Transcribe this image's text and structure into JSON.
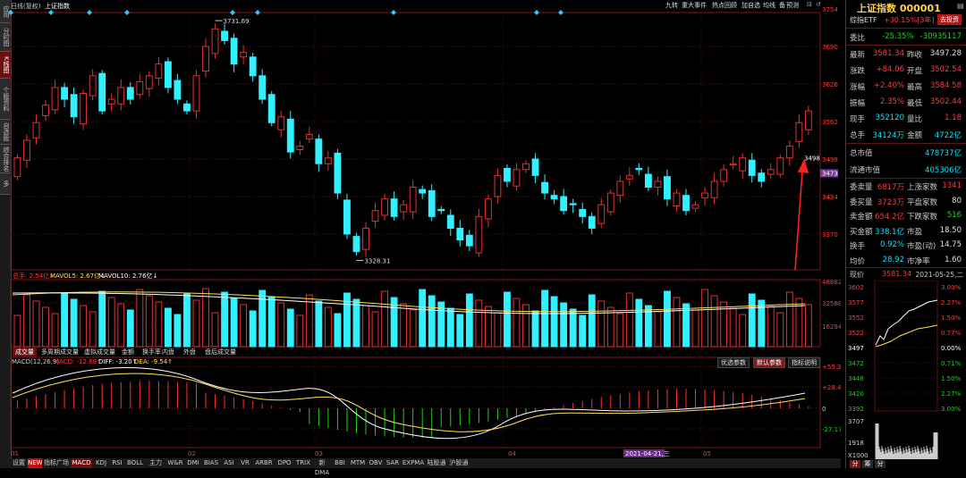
{
  "left_tabs": [
    "应用",
    "分时图",
    "K线图",
    "个股资料",
    "自选股",
    "综合排名",
    "多"
  ],
  "left_active": 2,
  "chart_header": {
    "period": "日线(复权)",
    "name": "上证指数"
  },
  "toolbar": [
    "九转",
    "重大事件",
    "热点回顾",
    "加自选",
    "均线",
    "备",
    "预测"
  ],
  "price_axis": {
    "labels": [
      "3754",
      "3690",
      "3626",
      "3562",
      "3498",
      "3434",
      "3370"
    ]
  },
  "price_current_tag": "3473",
  "last_price_label": "3498",
  "annotations": {
    "high": "3731.69",
    "low": "3328.31"
  },
  "volume_header": {
    "total": "总手: 2.54亿↓",
    "ma5": "MAVOL5: 2.67亿↓",
    "ma10": "MAVOL10: 2.76亿↓"
  },
  "volume_axis": [
    "48882",
    "32588",
    "16294"
  ],
  "volume_tabs": [
    "成交量",
    "多周期成交量",
    "虚拟成交量",
    "金额",
    "换手率",
    "内盘",
    "外盘",
    "盘后成交量"
  ],
  "macd_header": {
    "params": "MACD(12,26,9)",
    "macd": "MACD: -12.68↑",
    "diff": "DIFF: -3.20↑",
    "dea": "DEA: -9.54↑"
  },
  "macd_buttons": [
    "优选参数",
    "默认参数",
    "指标说明"
  ],
  "macd_axis": [
    "+55.30",
    "+28.48",
    "0",
    "-27.17"
  ],
  "x_axis": {
    "labels": [
      "01",
      "02",
      "03",
      "04",
      "05"
    ],
    "highlight": "2021-04-21,三"
  },
  "bottom_tabs": [
    "设置",
    "NEW",
    "指标广场",
    "MACD",
    "KDJ",
    "RSI",
    "BOLL",
    "主力",
    "W&R",
    "DMI",
    "BIAS",
    "ASI",
    "VR",
    "ARBR",
    "DPO",
    "TRIX",
    "新DMA",
    "BBI",
    "MTM",
    "OBV",
    "SAR",
    "EXPMA",
    "陆股通",
    "沪股通"
  ],
  "right_panel": {
    "title": "上证指数 000001",
    "etf": "综指ETF",
    "etf_change": "+30.15%[3年]",
    "go": "去投资",
    "ratio_label": "委比",
    "ratio_value": "-25.35%",
    "ratio_diff": "-30935117",
    "rows": [
      {
        "l1": "最新",
        "v1": "3581.34",
        "l2": "昨收",
        "v2": "3497.28"
      },
      {
        "l1": "涨跌",
        "v1": "+84.06",
        "l2": "开盘",
        "v2": "3502.54"
      },
      {
        "l1": "涨幅",
        "v1": "+2.40%",
        "l2": "最高",
        "v2": "3584.58"
      },
      {
        "l1": "振幅",
        "v1": "2.35%",
        "l2": "最低",
        "v2": "3502.44"
      },
      {
        "l1": "现手",
        "v1": "352120",
        "l2": "量比",
        "v2": "1.18"
      },
      {
        "l1": "总手",
        "v1": "34124万",
        "l2": "金额",
        "v2": "4722亿"
      }
    ],
    "mcap_label": "总市值",
    "mcap": "478737亿",
    "fmcap_label": "流通市值",
    "fmcap": "405306亿",
    "stats": [
      {
        "l1": "委卖量",
        "v1": "6817万",
        "l2": "上涨家数",
        "v2": "1341"
      },
      {
        "l1": "委买量",
        "v1": "3723万",
        "l2": "平盘家数",
        "v2": "80"
      },
      {
        "l1": "卖金额",
        "v1": "654.2亿",
        "l2": "下跌家数",
        "v2": "516"
      },
      {
        "l1": "买金额",
        "v1": "338.1亿",
        "l2": "市盈",
        "v2": "18.50"
      },
      {
        "l1": "换手",
        "v1": "0.92%",
        "l2": "市盈(动)",
        "v2": "14.75"
      },
      {
        "l1": "均价",
        "v1": "28.92",
        "l2": "市净率",
        "v2": "1.60"
      }
    ],
    "mini_label": "现价",
    "mini_price": "3581.34",
    "mini_date": "2021-05-25,二",
    "mini_left": [
      "3602",
      "3577",
      "3552",
      "3522",
      "3497",
      "3472",
      "3446",
      "3420",
      "3392"
    ],
    "mini_right": [
      "3.00%",
      "2.27%",
      "1.50%",
      "0.77%",
      "0.00%",
      "0.71%",
      "1.50%",
      "2.27%",
      "3.00%"
    ],
    "mini_vol": [
      "3707",
      "1918",
      "X1000"
    ],
    "mini_tabs": [
      "分",
      "筹",
      "分"
    ]
  }
}
